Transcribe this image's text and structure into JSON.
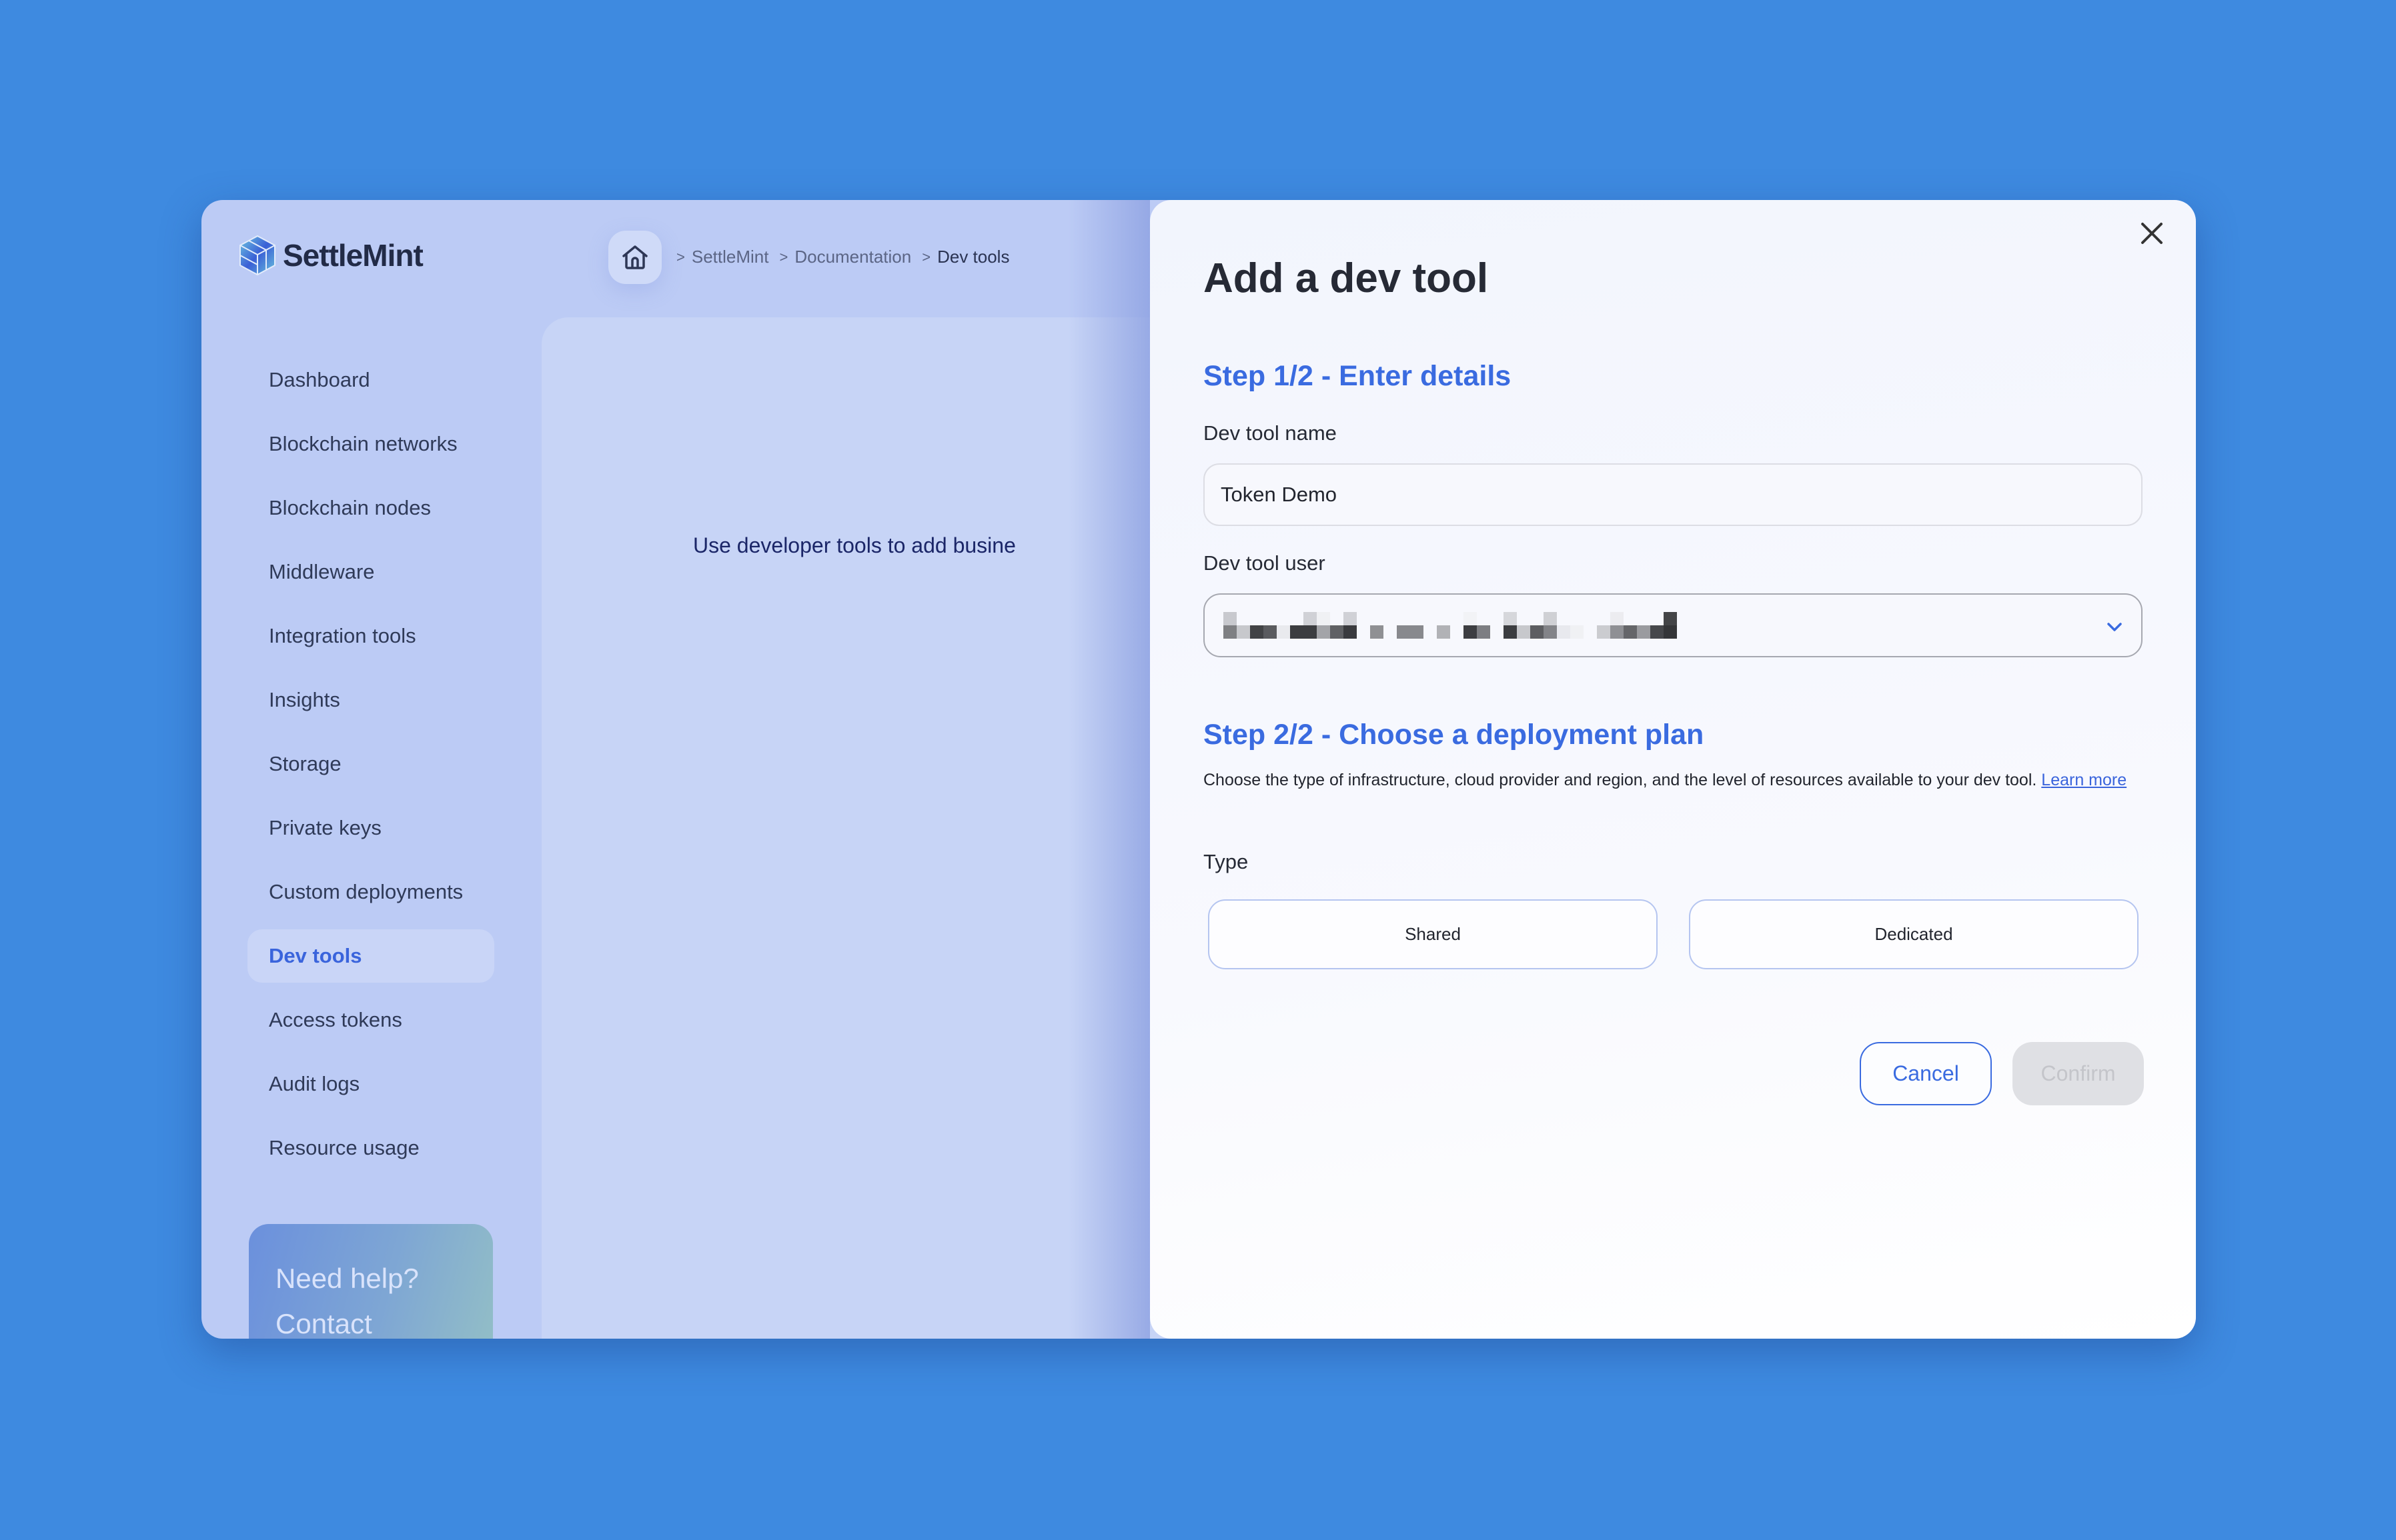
{
  "app": {
    "brand": "SettleMint"
  },
  "breadcrumb": {
    "separator": ">",
    "items": [
      "SettleMint",
      "Documentation",
      "Dev tools"
    ]
  },
  "sidebar": {
    "items": [
      {
        "label": "Dashboard",
        "active": false
      },
      {
        "label": "Blockchain networks",
        "active": false
      },
      {
        "label": "Blockchain nodes",
        "active": false
      },
      {
        "label": "Middleware",
        "active": false
      },
      {
        "label": "Integration tools",
        "active": false
      },
      {
        "label": "Insights",
        "active": false
      },
      {
        "label": "Storage",
        "active": false
      },
      {
        "label": "Private keys",
        "active": false
      },
      {
        "label": "Custom deployments",
        "active": false
      },
      {
        "label": "Dev tools",
        "active": true
      },
      {
        "label": "Access tokens",
        "active": false
      },
      {
        "label": "Audit logs",
        "active": false
      },
      {
        "label": "Resource usage",
        "active": false
      }
    ],
    "help_card": {
      "line1": "Need help?",
      "line2": "Contact"
    }
  },
  "main": {
    "intro_text": "Use developer tools to add busine"
  },
  "modal": {
    "title": "Add a dev tool",
    "close_icon": "close-icon",
    "step1": {
      "heading": "Step 1/2 - Enter details",
      "name_label": "Dev tool name",
      "name_value": "Token Demo",
      "user_label": "Dev tool user",
      "user_value": "[redacted]"
    },
    "step2": {
      "heading": "Step 2/2 - Choose a deployment plan",
      "description": "Choose the type of infrastructure, cloud provider and region, and the level of resources available to your dev tool.",
      "learn_more": "Learn more",
      "type_label": "Type",
      "type_options": [
        "Shared",
        "Dedicated"
      ]
    },
    "actions": {
      "cancel": "Cancel",
      "confirm": "Confirm"
    }
  },
  "colors": {
    "background": "#3e8ae0",
    "sidebar": "#bccbf5",
    "accent": "#3a6be0",
    "modal": "#f4f7fe",
    "confirm_disabled": "#dfe0e4"
  }
}
